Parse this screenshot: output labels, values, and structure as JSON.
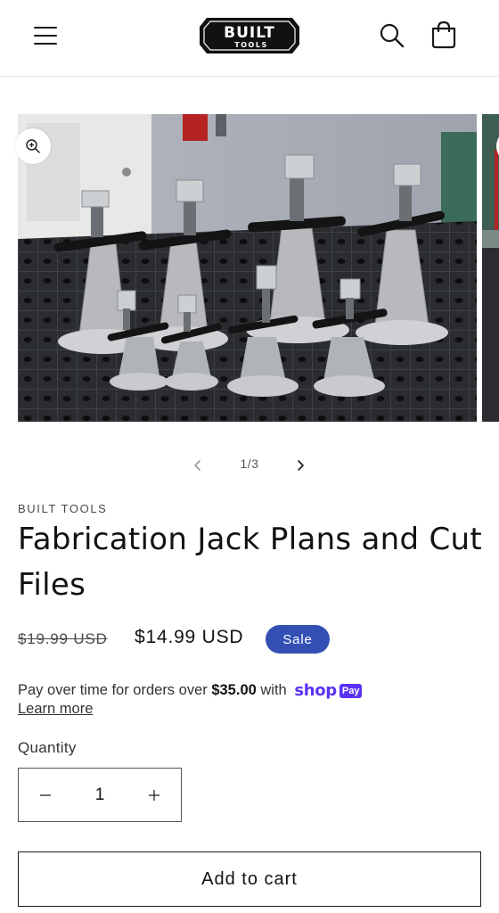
{
  "header": {
    "logo_text_top": "BUILT",
    "logo_text_bottom": "TOOLS",
    "menu_icon": "hamburger-icon",
    "search_icon": "search-icon",
    "cart_icon": "cart-icon"
  },
  "gallery": {
    "counter": "1/3",
    "current": 1,
    "total": 3,
    "zoom_icon": "zoom-in-icon",
    "prev_icon": "chevron-left-icon",
    "next_icon": "chevron-right-icon"
  },
  "product": {
    "vendor": "BUILT TOOLS",
    "title": "Fabrication Jack Plans and Cut Files",
    "compare_price": "$19.99 USD",
    "sale_price": "$14.99 USD",
    "sale_badge": "Sale"
  },
  "installments": {
    "text_before": "Pay over time for orders over ",
    "amount": "$35.00",
    "text_after": " with ",
    "shop_word": "shop",
    "pay_word": "Pay",
    "learn_more": "Learn more"
  },
  "quantity": {
    "label": "Quantity",
    "value": "1"
  },
  "cart": {
    "add_label": "Add to cart"
  },
  "colors": {
    "sale_badge": "#334fb4",
    "shop_pay": "#5a31f4",
    "text": "#121212"
  }
}
